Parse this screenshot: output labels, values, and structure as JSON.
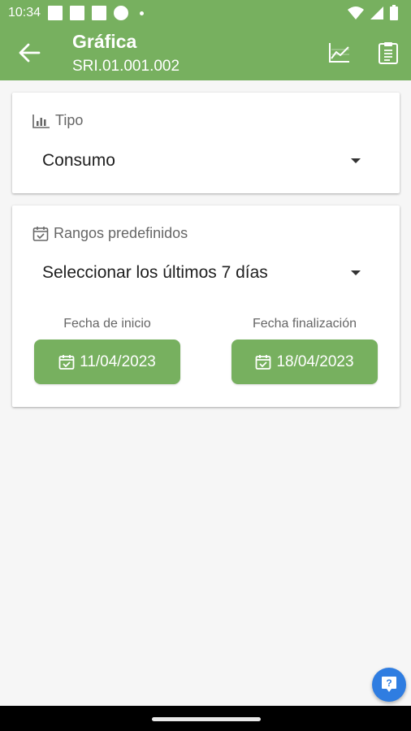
{
  "status_bar": {
    "time": "10:34"
  },
  "header": {
    "title": "Gráfica",
    "subtitle": "SRI.01.001.002"
  },
  "icons": {
    "back": "arrow-left-icon",
    "chart": "line-chart-icon",
    "clipboard": "clipboard-icon",
    "help": "help-icon",
    "calendar": "calendar-check-icon",
    "bar_chart": "bar-chart-icon"
  },
  "colors": {
    "primary": "#77b05f",
    "fab": "#2f7de1"
  },
  "tipo": {
    "label": "Tipo",
    "value": "Consumo"
  },
  "rangos": {
    "label": "Rangos predefinidos",
    "value": "Seleccionar los últimos 7 días",
    "start_label": "Fecha de inicio",
    "start_date": "11/04/2023",
    "end_label": "Fecha finalización",
    "end_date": "18/04/2023"
  }
}
